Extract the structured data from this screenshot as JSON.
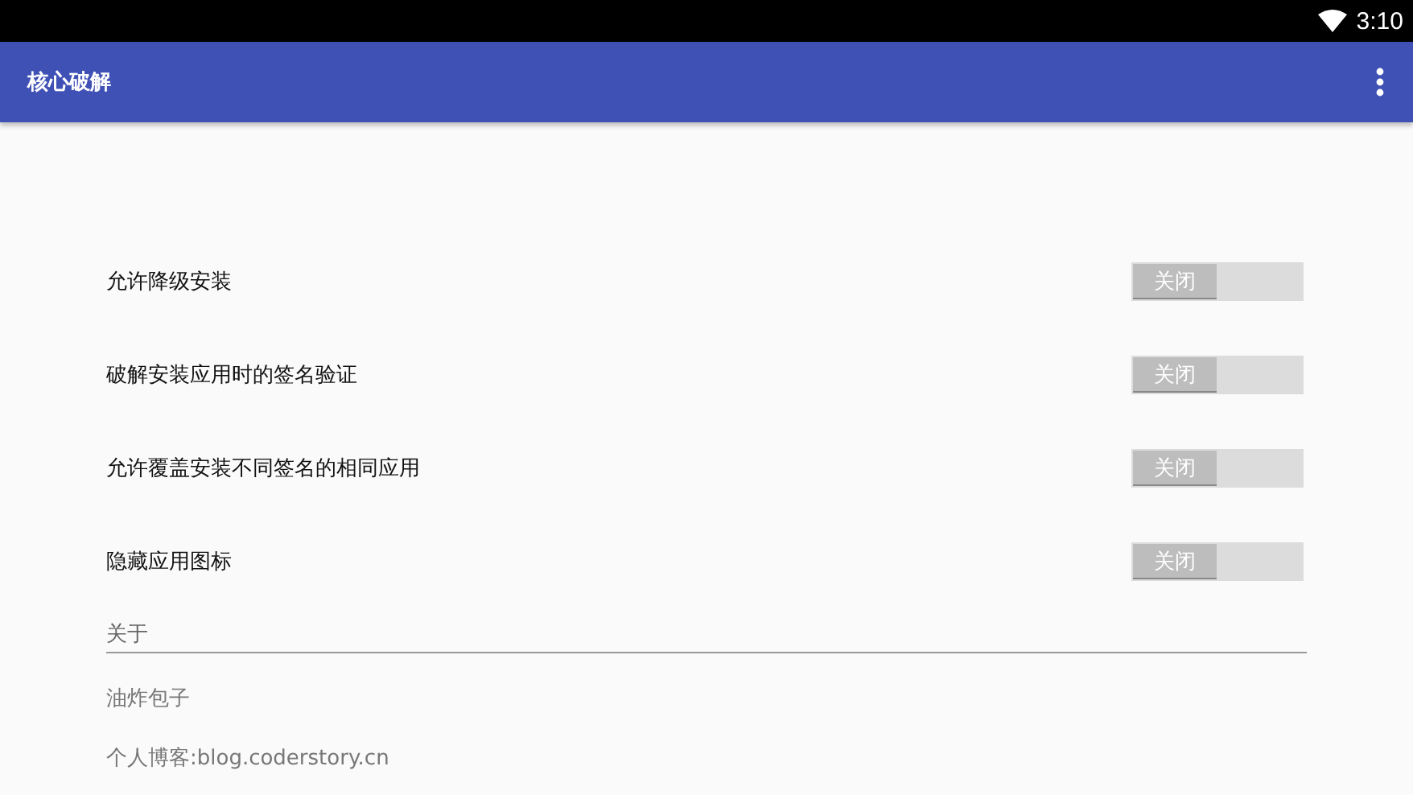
{
  "status_bar": {
    "time": "3:10"
  },
  "app_bar": {
    "title": "核心破解"
  },
  "settings": [
    {
      "label": "允许降级安装",
      "switch_text": "关闭",
      "on": false
    },
    {
      "label": "破解安装应用时的签名验证",
      "switch_text": "关闭",
      "on": false
    },
    {
      "label": "允许覆盖安装不同签名的相同应用",
      "switch_text": "关闭",
      "on": false
    },
    {
      "label": "隐藏应用图标",
      "switch_text": "关闭",
      "on": false
    }
  ],
  "about": {
    "heading": "关于",
    "items": [
      "油炸包子",
      "个人博客:blog.coderstory.cn"
    ]
  }
}
